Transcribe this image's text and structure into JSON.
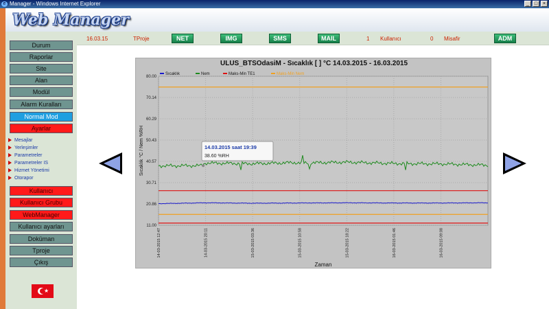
{
  "window": {
    "title": "Manager - Windows Internet Explorer",
    "controls": [
      "_",
      "□",
      "×"
    ]
  },
  "app": {
    "logo_text": "Web Manager"
  },
  "infobar": {
    "date": "16.03.15",
    "project": "TProje",
    "buttons": {
      "net": "NET",
      "img": "IMG",
      "sms": "SMS",
      "mail": "MAIL",
      "adm": "ADM"
    },
    "user_count": "1",
    "user_label": "Kullanıcı",
    "guest_count": "0",
    "guest_label": "Misafir"
  },
  "sidebar": {
    "menu_top": [
      "Durum",
      "Raporlar",
      "Site",
      "Alan",
      "Modül",
      "Alarm Kuralları"
    ],
    "normal_mode": "Normal Mod",
    "ayarlar": "Ayarlar",
    "submenu": [
      "Mesajlar",
      "Yerleşimler",
      "Parametreler",
      "Parametreler IS",
      "Hizmet Yönetimi",
      "Otorapor"
    ],
    "menu_red": [
      "Kullanıcı",
      "Kullanıcı Grubu",
      "WebManager"
    ],
    "menu_bottom": [
      "Kullanıcı ayarları",
      "Doküman",
      "Tproje",
      "Çıkış"
    ]
  },
  "colors": {
    "sicaklik": "#1a1acc",
    "nem": "#1e8a1e",
    "maks_min_te1": "#dd1111",
    "maks_min_nem": "#f0a020"
  },
  "chart_data": {
    "type": "line",
    "title": "ULUS_BTSOdasiM - Sıcaklık  [  ]  °C  14.03.2015 - 16.03.2015",
    "xlabel": "Zaman",
    "ylabel": "Sıcaklık °C / Nem %RH",
    "ylim": [
      11.0,
      80.0
    ],
    "yticks": [
      "80.00",
      "70.14",
      "60.29",
      "50.43",
      "40.57",
      "30.71",
      "20.86",
      "11.00"
    ],
    "xticks": [
      "14-03-2015 12:47",
      "14-03-2015 20:11",
      "15-03-2015 03:36",
      "15-03-2015 10:58",
      "15-03-2015 18:22",
      "16-03-2015 01:46",
      "16-03-2015 09:08"
    ],
    "legend": [
      "Sıcaklık",
      "Nem",
      "Maks-Min TE1",
      "Maks-Min Nem"
    ],
    "legend_position": "top-left",
    "grid": true,
    "tooltip": {
      "title": "14.03.2015 saat 19:39",
      "value": "38.60 %RH"
    },
    "series": [
      {
        "name": "Sıcaklık",
        "x": [
          0,
          1,
          2,
          3,
          4,
          5,
          6,
          7
        ],
        "values": [
          21.0,
          21.4,
          21.2,
          21.3,
          21.4,
          21.3,
          21.3,
          21.4
        ]
      },
      {
        "name": "Nem",
        "x": [
          0,
          0.9,
          1,
          2,
          2.9,
          3,
          4,
          5,
          6,
          7
        ],
        "values": [
          38.5,
          38.6,
          39.8,
          39.5,
          40.0,
          39.8,
          40.2,
          39.6,
          39.4,
          38.8
        ]
      },
      {
        "name": "Maks-Min TE1",
        "x": [
          0,
          7
        ],
        "values": [
          27.0,
          27.0
        ]
      },
      {
        "name": "Maks-Min TE1",
        "x": [
          0,
          7
        ],
        "values": [
          12.0,
          12.0
        ]
      },
      {
        "name": "Maks-Min Nem",
        "x": [
          0,
          7
        ],
        "values": [
          75.0,
          75.0
        ]
      },
      {
        "name": "Maks-Min Nem",
        "x": [
          0,
          7
        ],
        "values": [
          16.0,
          16.0
        ]
      }
    ]
  }
}
